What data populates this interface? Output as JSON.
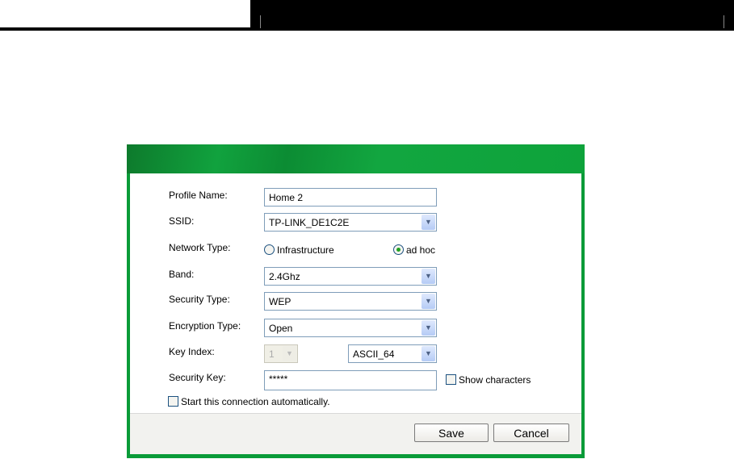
{
  "form": {
    "profile_name": {
      "label": "Profile Name:",
      "value": "Home 2"
    },
    "ssid": {
      "label": "SSID:",
      "value": "TP-LINK_DE1C2E"
    },
    "network_type": {
      "label": "Network Type:",
      "options": [
        "Infrastructure",
        "ad hoc"
      ],
      "selected": "ad hoc"
    },
    "band": {
      "label": "Band:",
      "value": "2.4Ghz"
    },
    "security_type": {
      "label": "Security Type:",
      "value": "WEP"
    },
    "encryption_type": {
      "label": "Encryption Type:",
      "value": "Open"
    },
    "key_index": {
      "label": "Key Index:",
      "value": "1",
      "key_format": "ASCII_64"
    },
    "security_key": {
      "label": "Security Key:",
      "value": "*****",
      "show_characters": "Show characters"
    },
    "auto_start": "Start this connection automatically."
  },
  "buttons": {
    "save": "Save",
    "cancel": "Cancel"
  }
}
